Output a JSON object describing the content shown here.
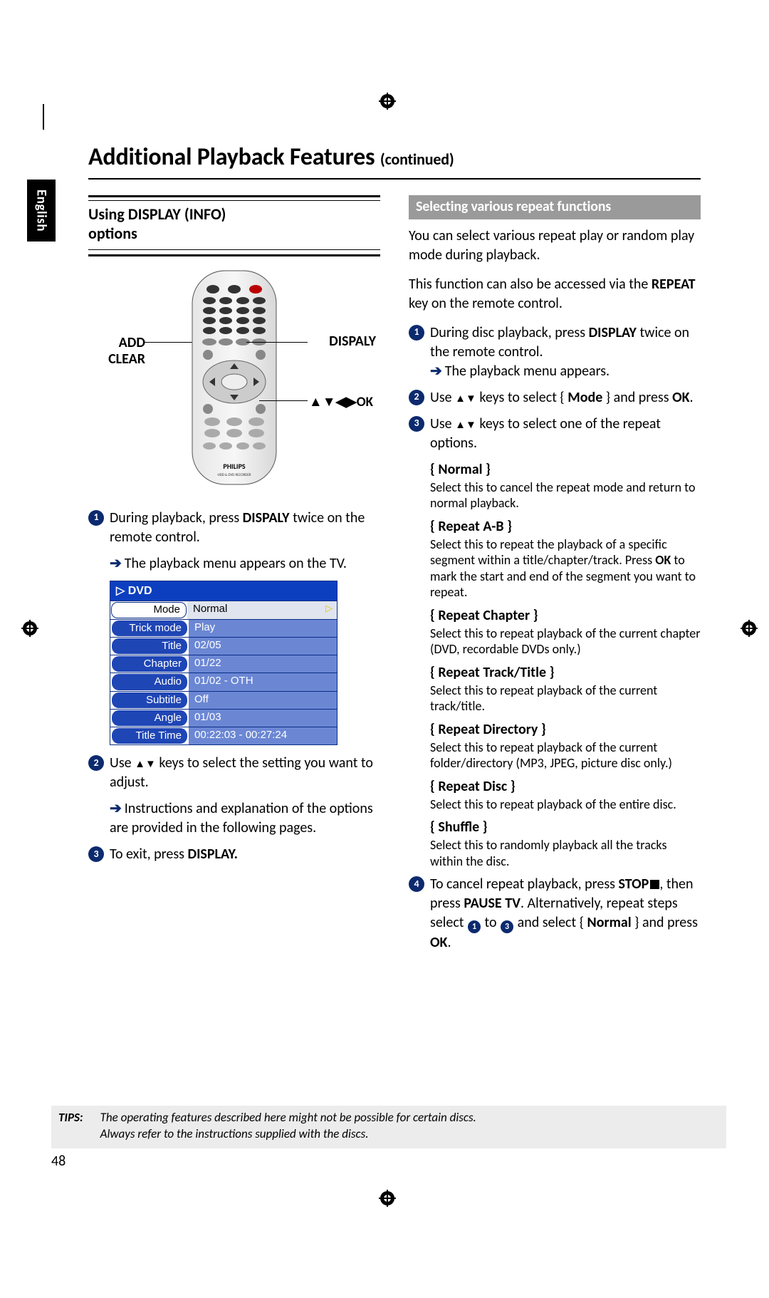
{
  "language_tab": "English",
  "page_title_main": "Additional Playback Features",
  "page_title_cont": "(continued)",
  "left": {
    "section_title_l1": "Using DISPLAY (INFO)",
    "section_title_l2": "options",
    "remote_label_left_1": "ADD",
    "remote_label_left_2": "CLEAR",
    "remote_label_right_1": "DISPALY",
    "remote_label_right_2": "▲▼◀▶OK",
    "remote_brand": "PHILIPS",
    "remote_subtext": "HDD & DVD RECORDER",
    "step1_pre": "During playback, press ",
    "step1_bold": "DISPALY",
    "step1_post": " twice on the remote control.",
    "step1_sub": "The playback menu appears on the TV.",
    "step2_pre": "Use ",
    "step2_keys": "▲▼",
    "step2_post": " keys to select the setting you want to adjust.",
    "step2_sub": "Instructions and explanation of the options are provided in the following pages.",
    "step3_pre": "To exit, press ",
    "step3_bold": "DISPLAY.",
    "osd_header": "▷  DVD",
    "osd_rows": [
      {
        "label": "Mode",
        "value": "Normal",
        "hi": true
      },
      {
        "label": "Trick mode",
        "value": "Play"
      },
      {
        "label": "Title",
        "value": "02/05"
      },
      {
        "label": "Chapter",
        "value": "01/22"
      },
      {
        "label": "Audio",
        "value": "01/02 - OTH"
      },
      {
        "label": "Subtitle",
        "value": "Off"
      },
      {
        "label": "Angle",
        "value": "01/03"
      },
      {
        "label": "Title Time",
        "value": "00:22:03 - 00:27:24"
      }
    ]
  },
  "right": {
    "subhead": "Selecting various repeat functions",
    "p1": "You can select various repeat play or random play mode during playback.",
    "p2_pre": "This function can also be accessed via the ",
    "p2_bold": "REPEAT",
    "p2_post": " key on the remote control.",
    "s1_pre": "During disc playback, press ",
    "s1_bold": "DISPLAY",
    "s1_post": " twice on the remote control.",
    "s1_sub": "The playback menu appears.",
    "s2_pre": "Use ",
    "s2_keys": "▲▼",
    "s2_mid": " keys to select { ",
    "s2_mode": "Mode",
    "s2_mid2": " } and press ",
    "s2_ok": "OK",
    "s2_end": ".",
    "s3_pre": "Use ",
    "s3_keys": "▲▼",
    "s3_post": " keys to select one of the repeat options.",
    "opts": [
      {
        "t": "{ Normal }",
        "d": "Select this to cancel the repeat mode and return to normal playback."
      },
      {
        "t": "{ Repeat A-B }",
        "d_pre": "Select this to repeat the playback of a specific segment within a title/chapter/track. Press ",
        "d_bold": "OK",
        "d_post": " to mark the start and end of the segment you want to repeat."
      },
      {
        "t": "{ Repeat Chapter }",
        "d": "Select this to repeat playback of the current chapter (DVD, recordable DVDs only.)"
      },
      {
        "t": "{ Repeat Track/Title }",
        "d": "Select this to repeat playback of the current track/title."
      },
      {
        "t": "{ Repeat Directory }",
        "d": "Select this to repeat playback of the current folder/directory (MP3, JPEG, picture disc only.)"
      },
      {
        "t": "{ Repeat Disc }",
        "d": "Select this to repeat playback of the entire disc."
      },
      {
        "t": "{ Shuffle }",
        "d": "Select this to randomly playback all the tracks within the disc."
      }
    ],
    "s4_a": "To cancel repeat playback, press ",
    "s4_stop": "STOP",
    "s4_b": ", then press ",
    "s4_pause": "PAUSE TV",
    "s4_c": ". Alternatively, repeat steps select ",
    "s4_d": " to ",
    "s4_e": " and select { ",
    "s4_norm": "Normal",
    "s4_f": " } and press ",
    "s4_ok": "OK",
    "s4_g": "."
  },
  "tips_label": "TIPS:",
  "tips_line1": "The operating features described here might not be possible for certain discs.",
  "tips_line2": "Always refer to the instructions supplied with the discs.",
  "page_number": "48"
}
